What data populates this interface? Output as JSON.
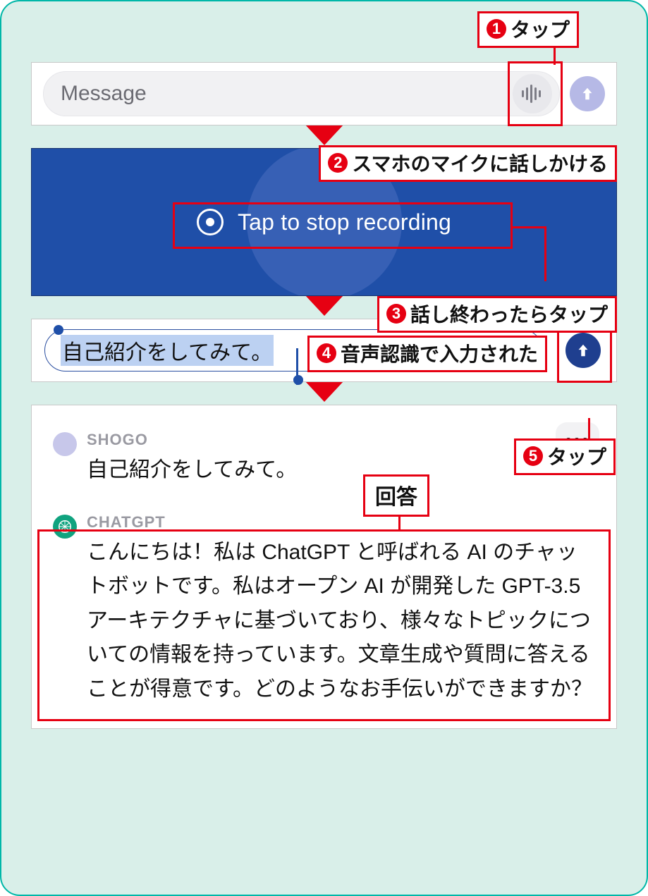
{
  "callouts": {
    "c1": "タップ",
    "c2": "スマホのマイクに話しかける",
    "c3": "話し終わったらタップ",
    "c4": "音声認識で入力された",
    "c5": "タップ",
    "answer": "回答"
  },
  "panel1": {
    "placeholder": "Message"
  },
  "panel2": {
    "stop_label": "Tap to stop recording"
  },
  "panel3": {
    "recognized": "自己紹介をしてみて。"
  },
  "panel4": {
    "more": "•••",
    "user": {
      "name": "SHOGO",
      "text": "自己紹介をしてみて。"
    },
    "bot": {
      "name": "CHATGPT",
      "text": "こんにちは！私は ChatGPT と呼ばれる AI のチャットボットです。私はオープン AI が開発した GPT-3.5 アーキテクチャに基づいており、様々なトピックについての情報を持っています。文章生成や質問に答えることが得意です。どのようなお手伝いができますか？"
    }
  },
  "nums": {
    "n1": "1",
    "n2": "2",
    "n3": "3",
    "n4": "4",
    "n5": "5"
  }
}
